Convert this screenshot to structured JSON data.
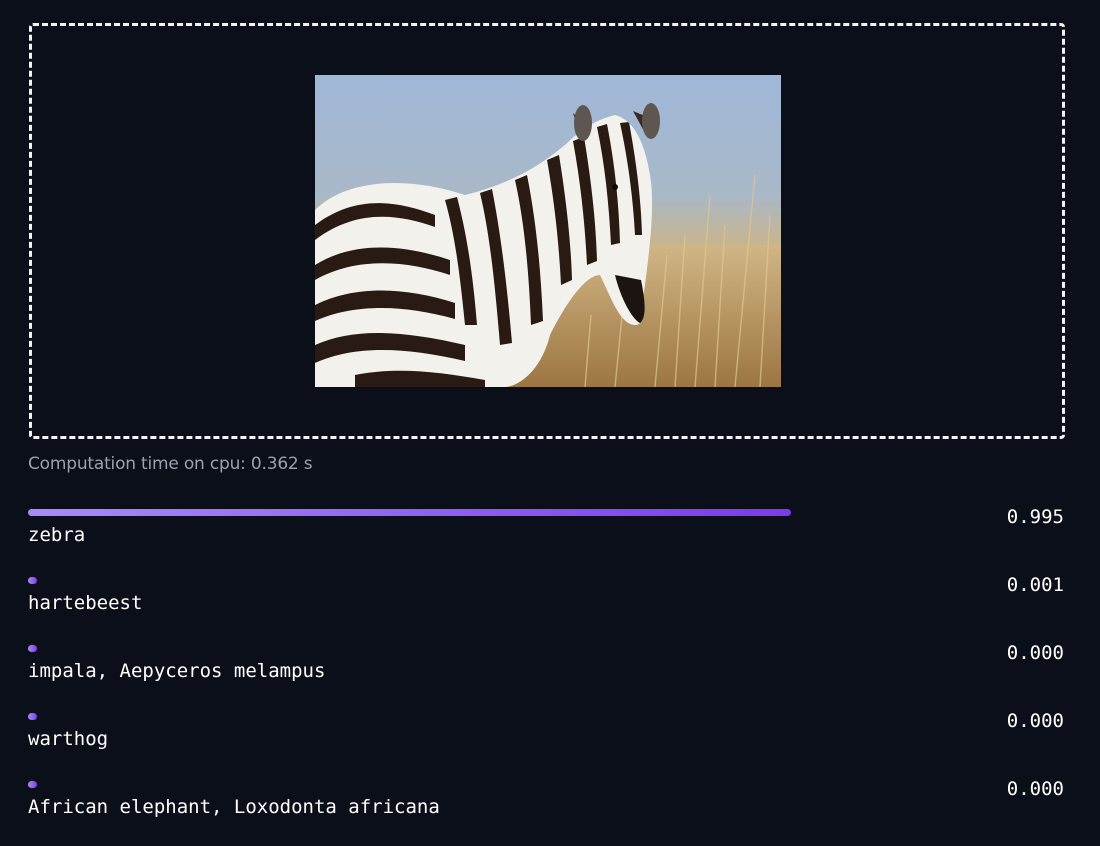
{
  "output": {
    "computation_time": "Computation time on cpu: 0.362 s",
    "labels": [
      {
        "name": "zebra",
        "confidence": "0.995",
        "fraction": 0.995
      },
      {
        "name": "hartebeest",
        "confidence": "0.001",
        "fraction": 0.001
      },
      {
        "name": "impala, Aepyceros melampus",
        "confidence": "0.000",
        "fraction": 0.0
      },
      {
        "name": "warthog",
        "confidence": "0.000",
        "fraction": 0.0
      },
      {
        "name": "African elephant, Loxodonta africana",
        "confidence": "0.000",
        "fraction": 0.0
      }
    ]
  },
  "colors": {
    "background": "#0b0f19",
    "bar_start": "#a78bfa",
    "bar_end": "#7c3aed",
    "dropzone_border": "#f2f3f5"
  }
}
